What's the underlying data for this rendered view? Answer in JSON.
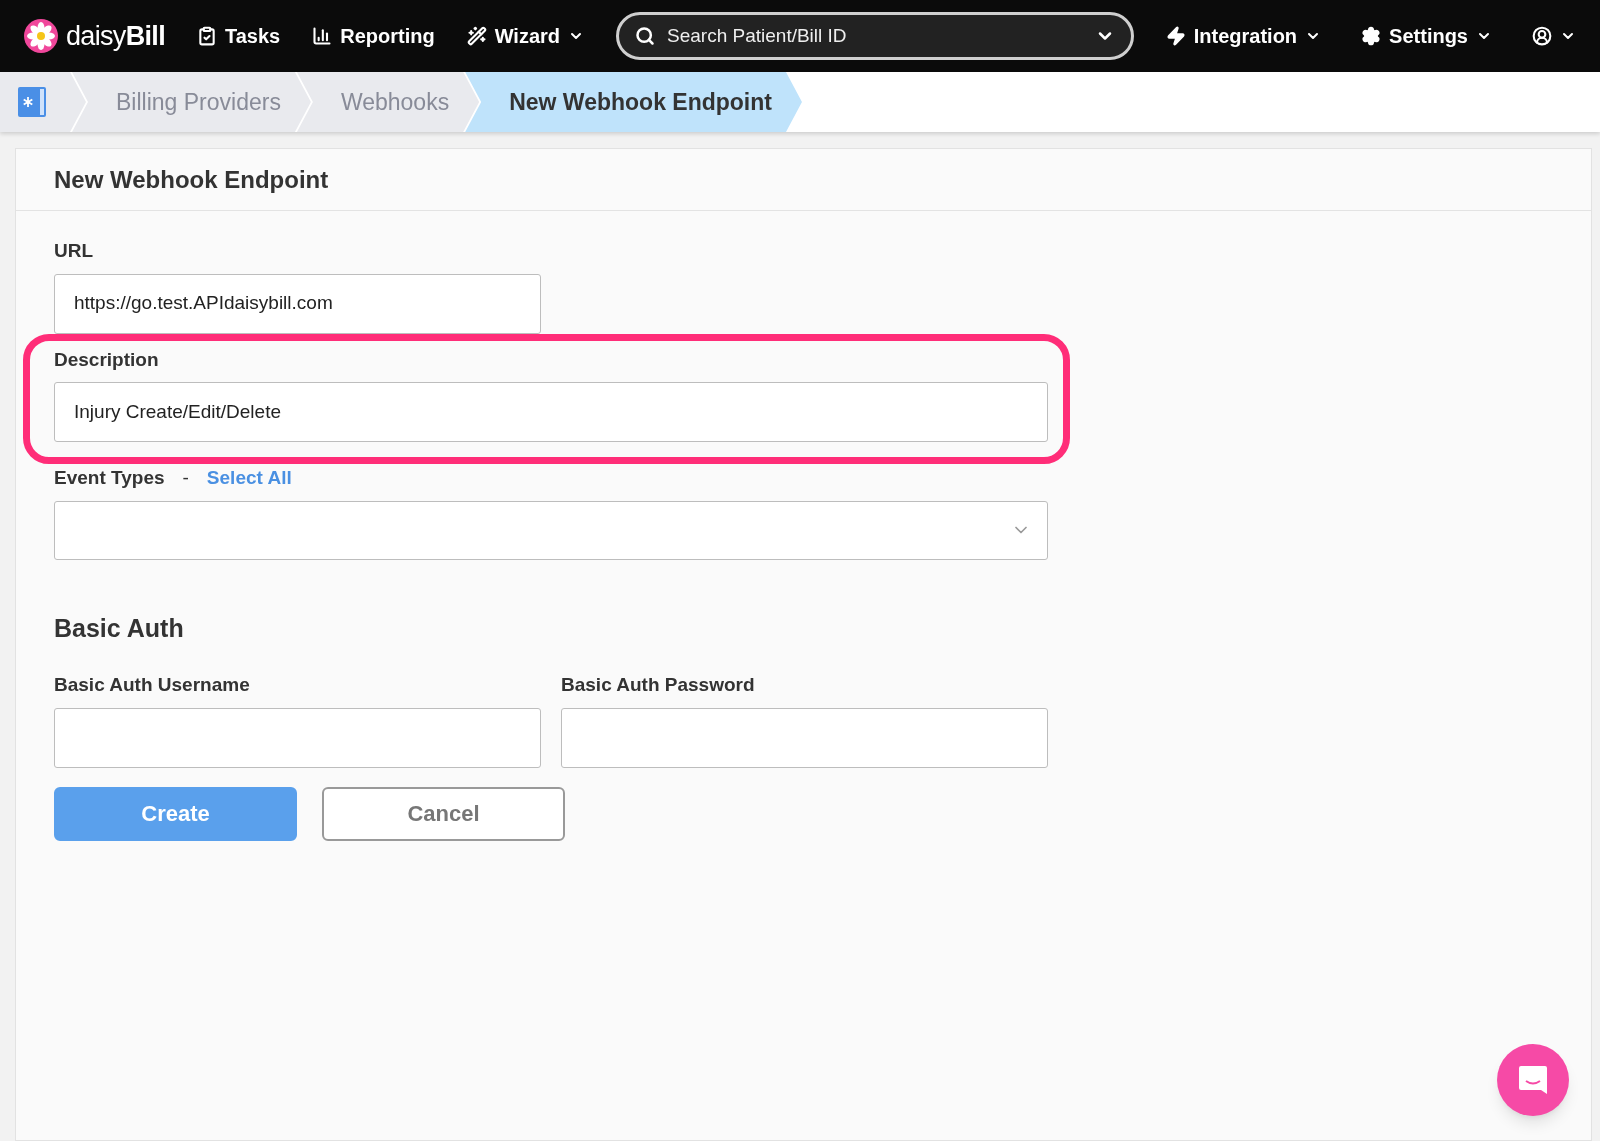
{
  "navbar": {
    "brand": {
      "light": "daisy",
      "bold": "Bill"
    },
    "items": [
      {
        "label": "Tasks",
        "dropdown": false
      },
      {
        "label": "Reporting",
        "dropdown": false
      },
      {
        "label": "Wizard",
        "dropdown": true
      }
    ],
    "search": {
      "placeholder": "Search Patient/Bill ID"
    },
    "right_items": [
      {
        "label": "Integration",
        "dropdown": true
      },
      {
        "label": "Settings",
        "dropdown": true
      },
      {
        "dropdown": true
      }
    ]
  },
  "breadcrumbs": [
    {
      "label": "Billing Providers",
      "selected": false
    },
    {
      "label": "Webhooks",
      "selected": false
    },
    {
      "label": "New Webhook Endpoint",
      "selected": true
    }
  ],
  "card": {
    "title": "New Webhook Endpoint",
    "url": {
      "label": "URL",
      "value": "https://go.test.APIdaisybill.com"
    },
    "description": {
      "label": "Description",
      "value": "Injury Create/Edit/Delete",
      "highlighted": true
    },
    "event_types": {
      "label": "Event Types",
      "separator": "-",
      "link": "Select All"
    },
    "basic_auth": {
      "heading": "Basic Auth",
      "fields": [
        {
          "label": "Basic Auth Username"
        },
        {
          "label": "Basic Auth Password"
        }
      ]
    },
    "buttons": [
      {
        "label": "Create",
        "kind": "primary"
      },
      {
        "label": "Cancel",
        "kind": "secondary"
      }
    ]
  }
}
